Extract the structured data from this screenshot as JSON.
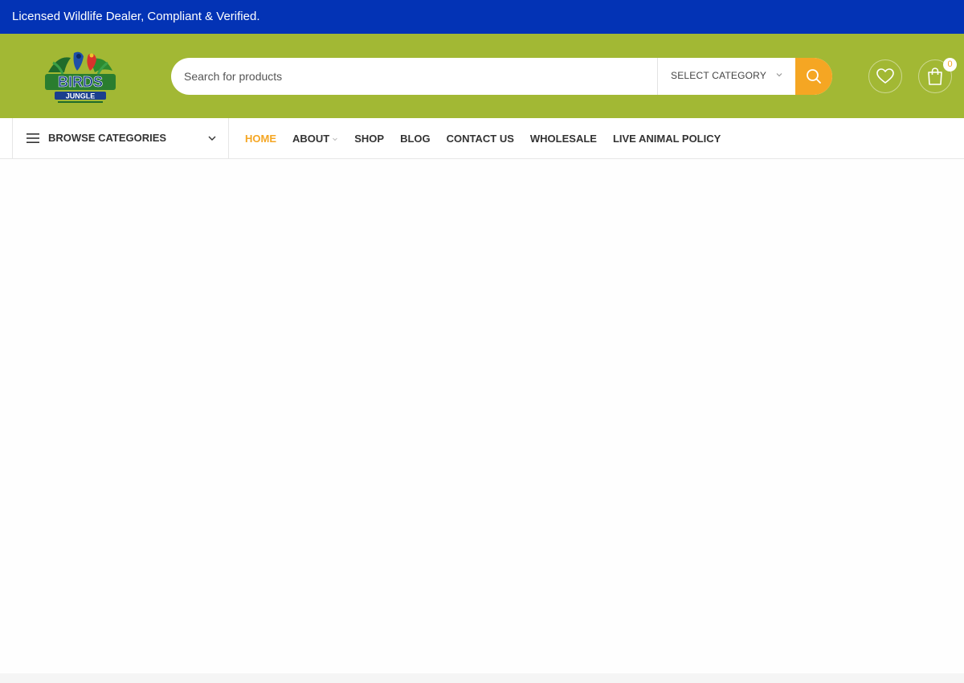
{
  "topbar": {
    "message": "Licensed Wildlife Dealer, Compliant & Verified."
  },
  "header": {
    "logo": {
      "icon": "birds-jungle-logo",
      "alt": "BIRDS JUNGLE"
    },
    "search": {
      "placeholder": "Search for products",
      "category_label": "SELECT CATEGORY",
      "submit_icon": "search-icon"
    },
    "wishlist_icon": "heart-icon",
    "cart": {
      "icon": "shopping-bag-icon",
      "count": "0"
    }
  },
  "nav": {
    "browse_label": "BROWSE CATEGORIES",
    "items": [
      {
        "label": "HOME",
        "active": true
      },
      {
        "label": "ABOUT",
        "has_submenu": true
      },
      {
        "label": "SHOP"
      },
      {
        "label": "BLOG"
      },
      {
        "label": "CONTACT US"
      },
      {
        "label": "WHOLESALE"
      },
      {
        "label": "LIVE ANIMAL POLICY"
      }
    ]
  },
  "colors": {
    "topbar": "#0333b5",
    "header": "#a2b834",
    "accent": "#f5a623"
  }
}
